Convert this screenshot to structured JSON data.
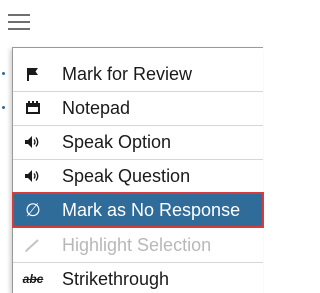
{
  "toolbar": {
    "menu_icon": "hamburger-menu-icon"
  },
  "menu": {
    "items": [
      {
        "label": "Mark for Review",
        "icon": "flag-icon"
      },
      {
        "label": "Notepad",
        "icon": "notepad-icon"
      },
      {
        "label": "Speak Option",
        "icon": "speaker-icon"
      },
      {
        "label": "Speak Question",
        "icon": "speaker-icon"
      },
      {
        "label": "Mark as No Response",
        "icon": "empty-set-icon",
        "state": "selected",
        "glyph": "∅"
      },
      {
        "label": "Highlight Selection",
        "icon": "highlighter-icon",
        "state": "disabled"
      },
      {
        "label": "Strikethrough",
        "icon": "strikethrough-abc-icon",
        "glyph": "abc"
      }
    ]
  },
  "colors": {
    "selected_bg": "#2f6c99",
    "selected_outline": "#d83b3b",
    "disabled_text": "#b8b8b8",
    "icon_color": "#1a1a1a"
  }
}
